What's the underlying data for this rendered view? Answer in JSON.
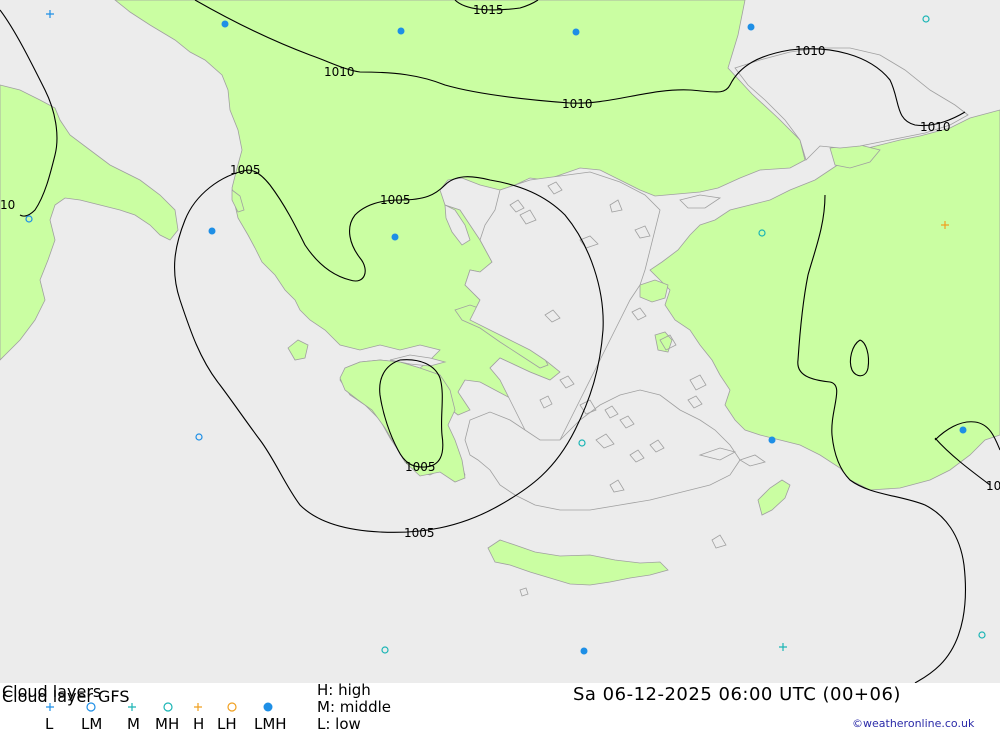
{
  "colors": {
    "sea": "#ececec",
    "land": "#cafea2",
    "coast": "#a0a0a0",
    "isobar": "#000000",
    "legend_blue": "#1e8fe6",
    "legend_cyan": "#1bb5b5",
    "legend_orange": "#f0a020"
  },
  "isobar_labels": [
    "1015",
    "1010",
    "1010",
    "1010",
    "1010",
    "1005",
    "1005",
    "1005",
    "1005",
    "10",
    "10"
  ],
  "footer": {
    "title_line1": "Cloud layers",
    "title_line2": "Cloud layer   GFS",
    "legend": [
      {
        "label": "L",
        "icon": "plus-blue"
      },
      {
        "label": "LM",
        "icon": "circle-blue"
      },
      {
        "label": "M",
        "icon": "plus-cyan"
      },
      {
        "label": "MH",
        "icon": "circle-cyan"
      },
      {
        "label": "H",
        "icon": "plus-orange"
      },
      {
        "label": "LH",
        "icon": "circle-orange"
      },
      {
        "label": "LMH",
        "icon": "dot-blue"
      }
    ],
    "key_high": "H: high",
    "key_middle": "M: middle",
    "key_low": "L: low",
    "datetime": "Sa 06-12-2025 06:00 UTC (00+06)",
    "credit": "©weatheronline.co.uk"
  }
}
